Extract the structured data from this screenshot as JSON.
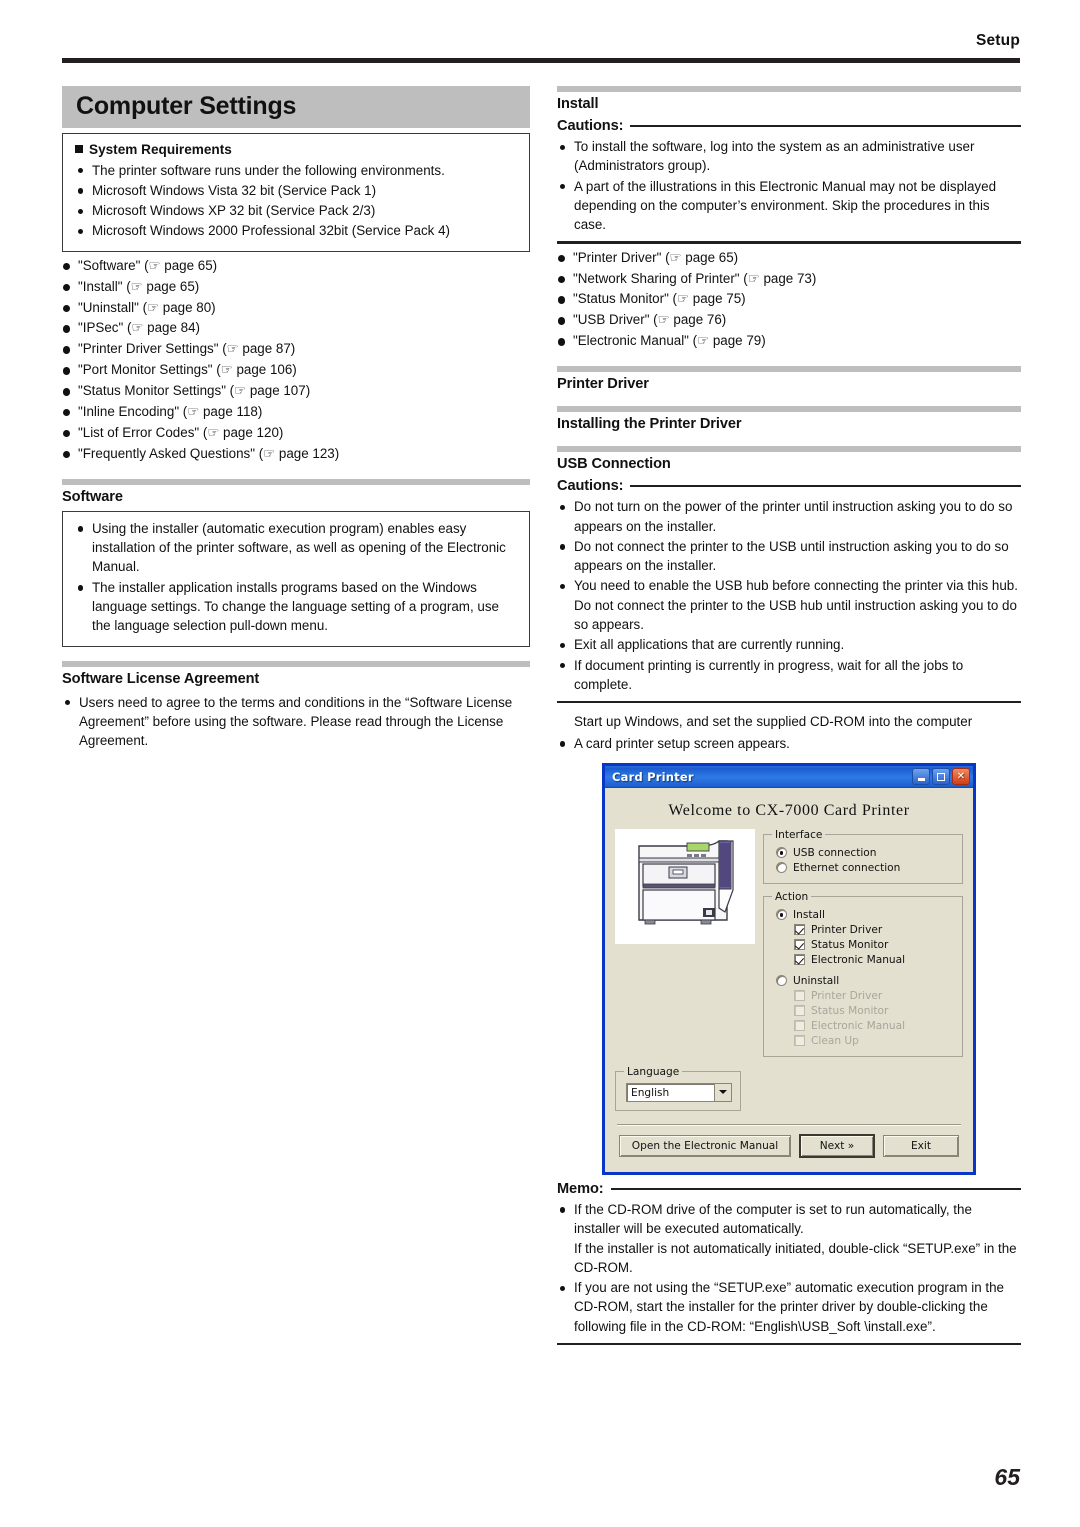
{
  "header": {
    "running_head": "Setup"
  },
  "chapter": {
    "title": "Computer Settings"
  },
  "system_requirements": {
    "title": "System Requirements",
    "items": [
      "The printer software runs under the following environments.",
      "Microsoft Windows Vista 32 bit (Service Pack 1)",
      "Microsoft Windows XP 32 bit (Service Pack 2/3)",
      "Microsoft Windows 2000 Professional 32bit (Service Pack 4)"
    ]
  },
  "toc_left": [
    "\"Software\" (☞ page 65)",
    "\"Install\" (☞ page 65)",
    "\"Uninstall\" (☞ page 80)",
    "\"IPSec\" (☞ page 84)",
    "\"Printer Driver Settings\" (☞ page 87)",
    "\"Port Monitor Settings\" (☞ page 106)",
    "\"Status Monitor Settings\" (☞ page 107)",
    "\"Inline Encoding\" (☞ page 118)",
    "\"List of Error Codes\" (☞ page 120)",
    "\"Frequently Asked Questions\" (☞ page 123)"
  ],
  "software": {
    "heading": "Software",
    "items": [
      "Using the installer (automatic execution program) enables easy installation of the printer software, as well as opening of the Electronic Manual.",
      "The installer application installs programs based on the Windows language settings. To change the language setting of a program, use the language selection pull-down menu."
    ]
  },
  "license": {
    "heading": "Software License Agreement",
    "items": [
      "Users need to agree to the terms and conditions in the “Software License Agreement” before using the software. Please read through the License Agreement."
    ]
  },
  "install": {
    "heading": "Install",
    "cautions_label": "Cautions:",
    "cautions": [
      "To install the software, log into the system as an administrative user (Administrators group).",
      "A part of the illustrations in this Electronic Manual may not be displayed depending on the computer’s environment. Skip the procedures in this case."
    ],
    "links": [
      "\"Printer Driver\" (☞ page 65)",
      "\"Network Sharing of Printer\" (☞ page 73)",
      "\"Status Monitor\" (☞ page 75)",
      "\"USB Driver\" (☞ page 76)",
      "\"Electronic Manual\" (☞ page 79)"
    ]
  },
  "printer_driver": {
    "heading": "Printer Driver",
    "sub_heading": "Installing the Printer Driver"
  },
  "usb_connection": {
    "heading": "USB Connection",
    "cautions_label": "Cautions:",
    "cautions": [
      "Do not turn on the power of the printer until instruction asking you to do so appears on the installer.",
      "Do not connect the printer to the USB until instruction asking you to do so appears on the installer.",
      "You need to enable the USB hub before connecting the printer via this hub. Do not connect the printer to the USB hub until instruction asking you to do so appears.",
      "Exit all applications that are currently running.",
      "If document printing is currently in progress, wait for all the jobs to complete."
    ],
    "step_text": "Start up Windows, and set the supplied CD-ROM into the computer",
    "step_bullets": [
      "A card printer setup screen appears."
    ]
  },
  "dialog": {
    "title": "Card Printer",
    "minimize_label": "–",
    "maximize_label": "□",
    "close_label": "✕",
    "welcome": "Welcome to CX-7000 Card Printer",
    "interface": {
      "legend": "Interface",
      "options": [
        {
          "label": "USB connection",
          "selected": true
        },
        {
          "label": "Ethernet connection",
          "selected": false
        }
      ]
    },
    "action": {
      "legend": "Action",
      "install_label": "Install",
      "install_selected": true,
      "install_items": [
        {
          "label": "Printer Driver",
          "checked": true
        },
        {
          "label": "Status Monitor",
          "checked": true
        },
        {
          "label": "Electronic Manual",
          "checked": true
        }
      ],
      "uninstall_label": "Uninstall",
      "uninstall_selected": false,
      "uninstall_items": [
        {
          "label": "Printer Driver",
          "checked": false
        },
        {
          "label": "Status Monitor",
          "checked": false
        },
        {
          "label": "Electronic Manual",
          "checked": false
        },
        {
          "label": "Clean Up",
          "checked": false
        }
      ]
    },
    "language": {
      "legend": "Language",
      "value": "English"
    },
    "buttons": {
      "manual": "Open the Electronic Manual",
      "next": "Next »",
      "exit": "Exit"
    }
  },
  "memo": {
    "label": "Memo:",
    "items": [
      "If the CD-ROM drive of the computer is set to run automatically, the installer will be executed automatically.\nIf the installer is not automatically initiated, double-click “SETUP.exe” in the CD-ROM.",
      "If you are not using the “SETUP.exe” automatic execution program in the CD-ROM, start the installer for the printer driver by double-clicking the following file in the CD-ROM: “English\\USB_Soft \\install.exe”."
    ]
  },
  "folio": "65"
}
